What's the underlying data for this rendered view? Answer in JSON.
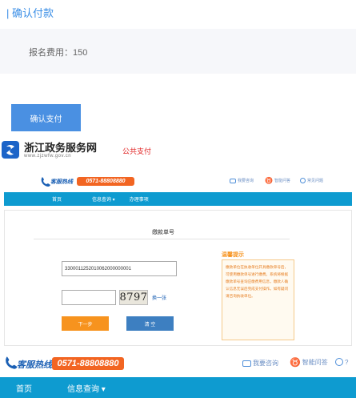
{
  "section_title": "| 确认付款",
  "fee": {
    "label": "报名费用：",
    "amount": "150"
  },
  "confirm_button_label": "确认支付",
  "portal": {
    "name": "浙江政务服务网",
    "url": "www.zjzwfw.gov.cn",
    "logo_icon": "zhejiang-gov-service-logo",
    "public_payment_label": "公共支付"
  },
  "embedded_page": {
    "hotline_label": "客服热线",
    "hotline_number": "0571-88808880",
    "hotline_icon": "phone-icon",
    "top_links": [
      {
        "label": "我要咨询",
        "icon": "chat-icon"
      },
      {
        "label": "智能问答",
        "icon": "robot-icon"
      },
      {
        "label": "常见问题",
        "icon": "question-icon"
      }
    ],
    "nav": {
      "home": "首页",
      "info_query": "信息查询 ▾",
      "guide": "办理事项"
    },
    "panel_title": "缴款单号",
    "payment_code_value": "3300011252010062000000001",
    "captcha_text": "8797",
    "refresh_label": "换一张",
    "next_button_label": "下一步",
    "clear_button_label": "清 空",
    "tip_title": "温馨提示",
    "tip_text": "缴款单位在执收单位开具缴款单号后，可使用缴款单号进行缴费。系统将根据缴款单号查询应缴费用信息，缴款人确认信息无误后完成支付操作。如有疑问请咨询执收单位。"
  },
  "bottom_bar": {
    "hotline_label": "客服热线",
    "hotline_number": "0571-88808880",
    "top_links": [
      {
        "label": "我要咨询",
        "icon": "chat-icon"
      },
      {
        "label": "智能问答",
        "icon": "robot-icon"
      },
      {
        "label": "?",
        "icon": "question-icon"
      }
    ],
    "nav": {
      "home": "首页",
      "info_query": "信息查询 ▾"
    }
  },
  "colors": {
    "accent_blue": "#4a90e2",
    "nav_blue": "#0e9bd0",
    "hotline_orange": "#f26522",
    "next_orange": "#f7931e",
    "public_pay_red": "#e02020"
  }
}
